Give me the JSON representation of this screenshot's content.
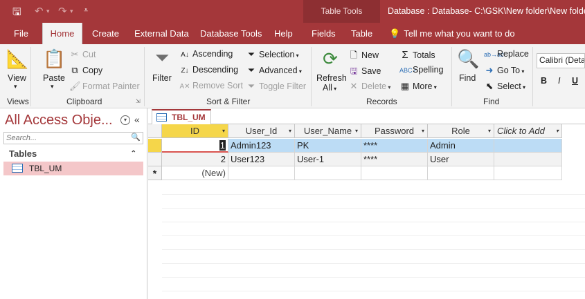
{
  "titlebar": {
    "context_label": "Table Tools",
    "doc_title": "Database : Database- C:\\GSK\\New folder\\New folder\\New"
  },
  "tabs": [
    "File",
    "Home",
    "Create",
    "External Data",
    "Database Tools",
    "Help",
    "Fields",
    "Table"
  ],
  "tell_me": "Tell me what you want to do",
  "ribbon": {
    "views": {
      "group": "Views",
      "view": "View"
    },
    "clipboard": {
      "group": "Clipboard",
      "paste": "Paste",
      "cut": "Cut",
      "copy": "Copy",
      "format_painter": "Format Painter"
    },
    "sort_filter": {
      "group": "Sort & Filter",
      "filter": "Filter",
      "ascending": "Ascending",
      "descending": "Descending",
      "remove_sort": "Remove Sort",
      "selection": "Selection",
      "advanced": "Advanced",
      "toggle_filter": "Toggle Filter"
    },
    "records": {
      "group": "Records",
      "refresh": "Refresh",
      "refresh_all": "All",
      "new": "New",
      "save": "Save",
      "delete": "Delete",
      "totals": "Totals",
      "spelling": "Spelling",
      "more": "More"
    },
    "find": {
      "group": "Find",
      "find": "Find",
      "replace": "Replace",
      "goto": "Go To",
      "select": "Select"
    },
    "text_formatting": {
      "font": "Calibri (Detail)",
      "bold": "B",
      "italic": "I",
      "underline": "U"
    }
  },
  "nav_pane": {
    "title": "All Access Obje...",
    "search_placeholder": "Search...",
    "category": "Tables",
    "items": [
      {
        "label": "TBL_UM"
      }
    ]
  },
  "doc_tab": {
    "label": "TBL_UM"
  },
  "table": {
    "columns": [
      "ID",
      "User_Id",
      "User_Name",
      "Password",
      "Role",
      "Click to Add"
    ],
    "rows": [
      {
        "id": "1",
        "user_id": "Admin123",
        "user_name": "PK",
        "password": "****",
        "role": "Admin"
      },
      {
        "id": "2",
        "user_id": "User123",
        "user_name": "User-1",
        "password": "****",
        "role": "User"
      }
    ],
    "new_row": "(New)",
    "new_row_marker": "*"
  },
  "colors": {
    "accent": "#a4373a",
    "ribbon": "#f3f3f3",
    "selected_row": "#bcdcf5",
    "header_selected": "#f5d64a"
  }
}
